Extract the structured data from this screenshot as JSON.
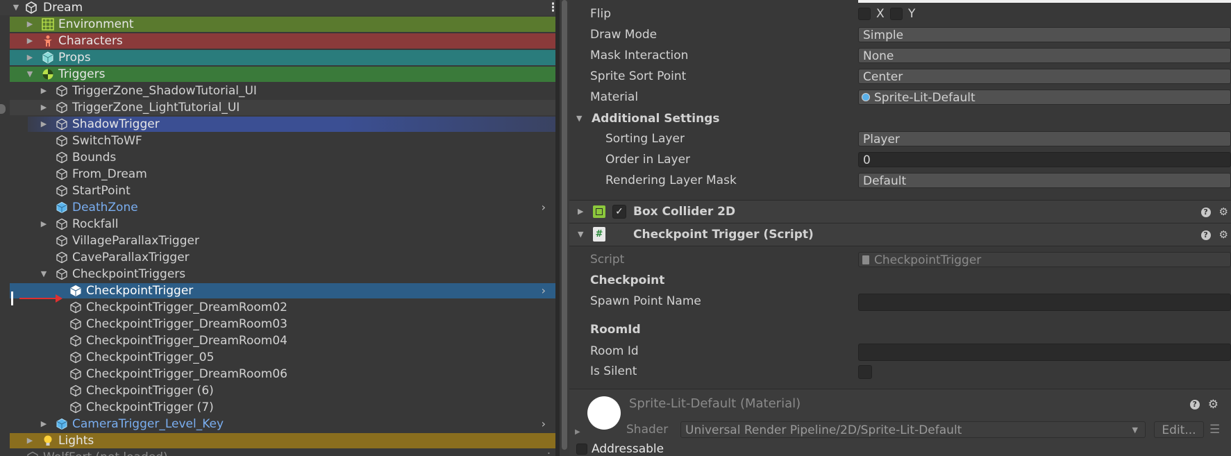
{
  "hierarchy": {
    "scene_name": "Dream",
    "rows": [
      {
        "label": "Environment",
        "arrow": "▶",
        "band": "#5a7a2e",
        "color": "#e6e6e6",
        "icon": "grid"
      },
      {
        "label": "Characters",
        "arrow": "▶",
        "band": "#8a3a3a",
        "color": "#e6e6e6",
        "icon": "person"
      },
      {
        "label": "Props",
        "arrow": "▶",
        "band": "#2a7c7c",
        "color": "#e6e6e6",
        "icon": "cube-solid"
      },
      {
        "label": "Triggers",
        "arrow": "▼",
        "band": "#3a7a3a",
        "color": "#e6e6e6",
        "icon": "ball"
      },
      {
        "label": "TriggerZone_ShadowTutorial_UI",
        "arrow": "▶",
        "band": "",
        "color": "#d2d2d2",
        "icon": "cube"
      },
      {
        "label": "TriggerZone_LightTutorial_UI",
        "arrow": "▶",
        "band": "#404040",
        "color": "#d2d2d2",
        "icon": "cube"
      },
      {
        "label": "ShadowTrigger",
        "arrow": "▶",
        "band": "#3b4f93",
        "color": "#e6e6e6",
        "icon": "cube"
      },
      {
        "label": "SwitchToWF",
        "arrow": "",
        "band": "",
        "color": "#d2d2d2",
        "icon": "cube"
      },
      {
        "label": "Bounds",
        "arrow": "",
        "band": "",
        "color": "#d2d2d2",
        "icon": "cube"
      },
      {
        "label": "From_Dream",
        "arrow": "",
        "band": "",
        "color": "#d2d2d2",
        "icon": "cube"
      },
      {
        "label": "StartPoint",
        "arrow": "",
        "band": "",
        "color": "#d2d2d2",
        "icon": "cube"
      },
      {
        "label": "DeathZone",
        "arrow": "",
        "band": "",
        "color": "#7aaef0",
        "icon": "cube-blue",
        "chevron": "›"
      },
      {
        "label": "Rockfall",
        "arrow": "▶",
        "band": "",
        "color": "#d2d2d2",
        "icon": "cube"
      },
      {
        "label": "VillageParallaxTrigger",
        "arrow": "",
        "band": "",
        "color": "#d2d2d2",
        "icon": "cube"
      },
      {
        "label": "CaveParallaxTrigger",
        "arrow": "",
        "band": "",
        "color": "#d2d2d2",
        "icon": "cube"
      },
      {
        "label": "CheckpointTriggers",
        "arrow": "▼",
        "band": "",
        "color": "#d2d2d2",
        "icon": "cube"
      },
      {
        "label": "CheckpointTrigger",
        "arrow": "",
        "band": "#2c5d87",
        "color": "#ffffff",
        "icon": "cube-white",
        "chevron": "›",
        "selected": true
      },
      {
        "label": "CheckpointTrigger_DreamRoom02",
        "arrow": "",
        "band": "",
        "color": "#d2d2d2",
        "icon": "cube"
      },
      {
        "label": "CheckpointTrigger_DreamRoom03",
        "arrow": "",
        "band": "",
        "color": "#d2d2d2",
        "icon": "cube"
      },
      {
        "label": "CheckpointTrigger_DreamRoom04",
        "arrow": "",
        "band": "",
        "color": "#d2d2d2",
        "icon": "cube"
      },
      {
        "label": "CheckpointTrigger_05",
        "arrow": "",
        "band": "",
        "color": "#d2d2d2",
        "icon": "cube"
      },
      {
        "label": "CheckpointTrigger_DreamRoom06",
        "arrow": "",
        "band": "",
        "color": "#d2d2d2",
        "icon": "cube"
      },
      {
        "label": "CheckpointTrigger (6)",
        "arrow": "",
        "band": "",
        "color": "#d2d2d2",
        "icon": "cube"
      },
      {
        "label": "CheckpointTrigger (7)",
        "arrow": "",
        "band": "",
        "color": "#d2d2d2",
        "icon": "cube"
      },
      {
        "label": "CameraTrigger_Level_Key",
        "arrow": "▶",
        "band": "",
        "color": "#7aaef0",
        "icon": "cube-blue",
        "chevron": "›"
      },
      {
        "label": "Lights",
        "arrow": "▶",
        "band": "#8a6e1e",
        "color": "#e6e6e6",
        "icon": "bulb"
      },
      {
        "label": "WolfFort (not loaded)",
        "arrow": "",
        "band": "",
        "color": "#8a8a8a",
        "icon": "scene"
      }
    ]
  },
  "inspector": {
    "flip_label": "Flip",
    "flip_x": "X",
    "flip_y": "Y",
    "draw_mode_label": "Draw Mode",
    "draw_mode_value": "Simple",
    "mask_label": "Mask Interaction",
    "mask_value": "None",
    "sort_point_label": "Sprite Sort Point",
    "sort_point_value": "Center",
    "material_label": "Material",
    "material_value": "Sprite-Lit-Default",
    "additional_label": "Additional Settings",
    "sorting_layer_label": "Sorting Layer",
    "sorting_layer_value": "Player",
    "order_label": "Order in Layer",
    "order_value": "0",
    "rendering_mask_label": "Rendering Layer Mask",
    "rendering_mask_value": "Default",
    "box_collider_label": "Box Collider 2D",
    "checkpoint_script_label": "Checkpoint Trigger (Script)",
    "script_label": "Script",
    "script_value": "CheckpointTrigger",
    "checkpoint_header": "Checkpoint",
    "spawn_label": "Spawn Point Name",
    "spawn_value": "",
    "roomid_header": "RoomId",
    "room_id_label": "Room Id",
    "room_id_value": "",
    "is_silent_label": "Is Silent",
    "material_preview_name": "Sprite-Lit-Default (Material)",
    "shader_label": "Shader",
    "shader_value": "Universal Render Pipeline/2D/Sprite-Lit-Default",
    "edit_label": "Edit...",
    "addressable_label": "Addressable"
  }
}
